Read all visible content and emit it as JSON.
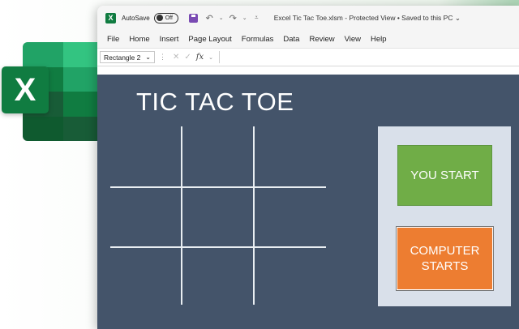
{
  "titlebar": {
    "app_icon_letter": "X",
    "autosave_label": "AutoSave",
    "autosave_state": "Off",
    "document_title": "Excel Tic Tac Toe.xlsm  -  Protected View  •  Saved to this PC ⌄"
  },
  "menu": [
    "File",
    "Home",
    "Insert",
    "Page Layout",
    "Formulas",
    "Data",
    "Review",
    "View",
    "Help"
  ],
  "formula_bar": {
    "name_box": "Rectangle 2",
    "fx_label": "fx"
  },
  "sheet": {
    "game_title": "TIC TAC TOE",
    "you_start_label": "YOU START",
    "computer_starts_label": "COMPUTER STARTS"
  },
  "logo": {
    "letter": "X"
  },
  "colors": {
    "sheet_bg": "#44546a",
    "panel_bg": "#d9e0ea",
    "you_start": "#70ad47",
    "computer_starts": "#ed7d31",
    "excel_green": "#107c41"
  }
}
